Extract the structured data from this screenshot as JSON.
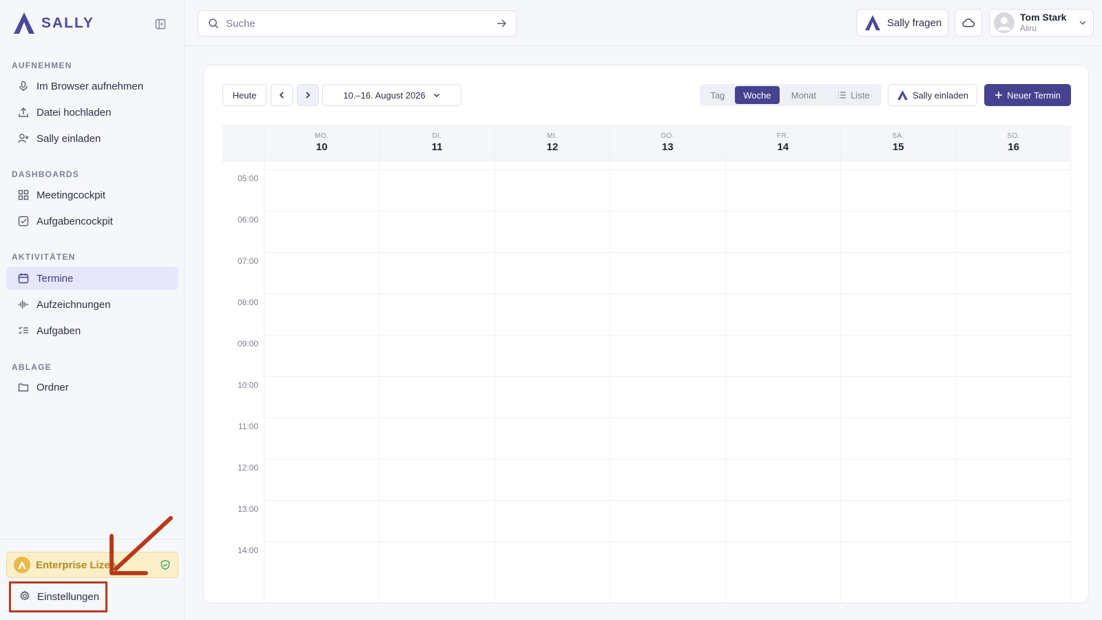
{
  "sidebar": {
    "brand_name": "SALLY",
    "sections": [
      {
        "title": "AUFNEHMEN"
      },
      {
        "title": "DASHBOARDS"
      },
      {
        "title": "AKTIVITÄTEN"
      },
      {
        "title": "ABLAGE"
      }
    ],
    "items": [
      {
        "label": "Im Browser aufnehmen",
        "icon": "microphone-icon"
      },
      {
        "label": "Datei hochladen",
        "icon": "upload-icon"
      },
      {
        "label": "Sally einladen",
        "icon": "user-plus-icon"
      },
      {
        "label": "Meetingcockpit",
        "icon": "grid-icon"
      },
      {
        "label": "Aufgabencockpit",
        "icon": "checkbox-icon"
      },
      {
        "label": "Termine",
        "icon": "calendar-icon",
        "active": true
      },
      {
        "label": "Aufzeichnungen",
        "icon": "waveform-icon"
      },
      {
        "label": "Aufgaben",
        "icon": "task-list-icon"
      },
      {
        "label": "Ordner",
        "icon": "folder-icon"
      }
    ],
    "license_label": "Enterprise Lizen",
    "settings_label": "Einstellungen"
  },
  "topbar": {
    "search_placeholder": "Suche",
    "ask_label": "Sally fragen",
    "user": {
      "name": "Tom Stark",
      "org": "Aliru"
    }
  },
  "toolbar": {
    "today_label": "Heute",
    "range_label": "10.–16. August 2026",
    "views": [
      {
        "label": "Tag",
        "active": false
      },
      {
        "label": "Woche",
        "active": true
      },
      {
        "label": "Monat",
        "active": false
      },
      {
        "label": "Liste",
        "active": false
      }
    ],
    "invite_label": "Sally einladen",
    "new_label": "Neuer Termin"
  },
  "calendar": {
    "days": [
      {
        "abbr": "MO.",
        "num": "10"
      },
      {
        "abbr": "DI.",
        "num": "11"
      },
      {
        "abbr": "MI.",
        "num": "12"
      },
      {
        "abbr": "DO.",
        "num": "13"
      },
      {
        "abbr": "FR.",
        "num": "14"
      },
      {
        "abbr": "SA.",
        "num": "15"
      },
      {
        "abbr": "SO.",
        "num": "16"
      }
    ],
    "hours": [
      "05:00",
      "06:00",
      "07:00",
      "08:00",
      "09:00",
      "10:00",
      "11:00",
      "12:00",
      "13:00",
      "14:00"
    ]
  },
  "colors": {
    "accent": "#45438f",
    "active_bg": "#e6e7fb",
    "license_bg": "#fbefc9",
    "annotation": "#b83a1a"
  }
}
